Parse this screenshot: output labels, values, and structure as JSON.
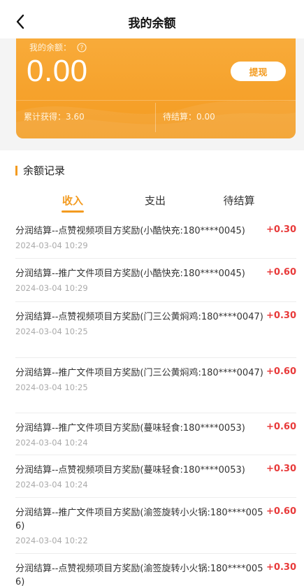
{
  "header": {
    "title": "我的余额"
  },
  "card": {
    "balance_label": "我的余额：",
    "balance": "0.00",
    "withdraw_label": "提现",
    "earned_label": "累计获得：3.60",
    "pending_label": "待结算：0.00"
  },
  "section": {
    "title": "余额记录"
  },
  "tabs": [
    {
      "label": "收入"
    },
    {
      "label": "支出"
    },
    {
      "label": "待结算"
    }
  ],
  "records": [
    {
      "desc": "分润结算--点赞视频项目方奖励(小酷快充:180****0045)",
      "amount": "+0.30",
      "time": "2024-03-04 10:29"
    },
    {
      "desc": "分润结算--推广文件项目方奖励(小酷快充:180****0045)",
      "amount": "+0.60",
      "time": "2024-03-04 10:29"
    },
    {
      "desc": "分润结算--点赞视频项目方奖励(门三公黄焖鸡:180****0047)",
      "amount": "+0.30",
      "time": "2024-03-04 10:25"
    },
    {
      "desc": "分润结算--推广文件项目方奖励(门三公黄焖鸡:180****0047)",
      "amount": "+0.60",
      "time": "2024-03-04 10:25"
    },
    {
      "desc": "分润结算--推广文件项目方奖励(蔓味轻食:180****0053)",
      "amount": "+0.60",
      "time": "2024-03-04 10:24"
    },
    {
      "desc": "分润结算--点赞视频项目方奖励(蔓味轻食:180****0053)",
      "amount": "+0.30",
      "time": "2024-03-04 10:24"
    },
    {
      "desc": "分润结算--推广文件项目方奖励(渝签旋转小火锅:180****0056)",
      "amount": "+0.60",
      "time": "2024-03-04 10:22"
    },
    {
      "desc": "分润结算--点赞视频项目方奖励(渝签旋转小火锅:180****0056)",
      "amount": "+0.30",
      "time": ""
    }
  ]
}
